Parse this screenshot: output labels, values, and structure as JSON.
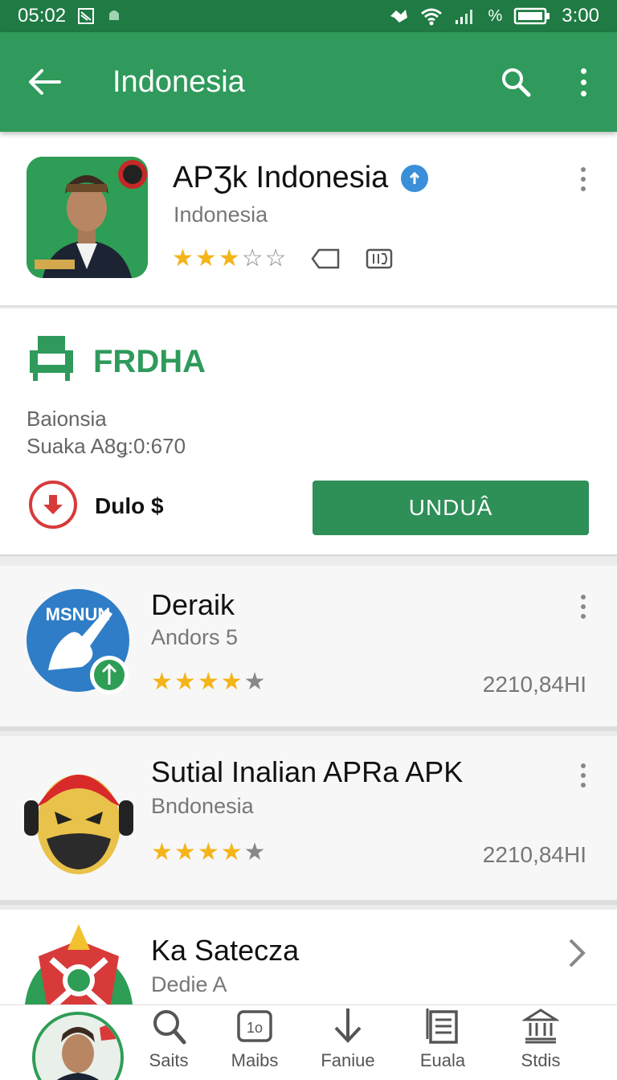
{
  "status_bar": {
    "left_time": "05:02",
    "right_time": "3:00"
  },
  "app_bar": {
    "title": "Indonesia"
  },
  "header": {
    "name": "APƷk Indonesia",
    "subtitle": "Indonesia",
    "rating": 3.5
  },
  "download_card": {
    "brand": "FRDHA",
    "line1": "Baionsia",
    "line2": "Suaka A8ǥ:0:670",
    "price": "Dulo $",
    "button_label": "UNDUÂ"
  },
  "list": [
    {
      "title": "Deraik",
      "subtitle": "Andors 5",
      "rating": 4,
      "count": "2210,84HI",
      "icon_text": "MSNUN"
    },
    {
      "title": "Sutial Inalian APRa APK",
      "subtitle": "Bndonesia",
      "rating": 4,
      "count": "2210,84HI"
    },
    {
      "title": "Ka Satecza",
      "subtitle": "Dedie A"
    }
  ],
  "bottom_nav": [
    {
      "label": "Saits",
      "icon": "search-icon"
    },
    {
      "label": "Maibs",
      "icon": "badge-icon"
    },
    {
      "label": "Faniue",
      "icon": "download-arrow-icon"
    },
    {
      "label": "Euala",
      "icon": "list-icon"
    },
    {
      "label": "Stdis",
      "icon": "bank-icon"
    }
  ],
  "colors": {
    "primary": "#2f9a5b",
    "status_bar": "#1f7a43",
    "button": "#2e8f57",
    "star": "#f4b41a"
  }
}
